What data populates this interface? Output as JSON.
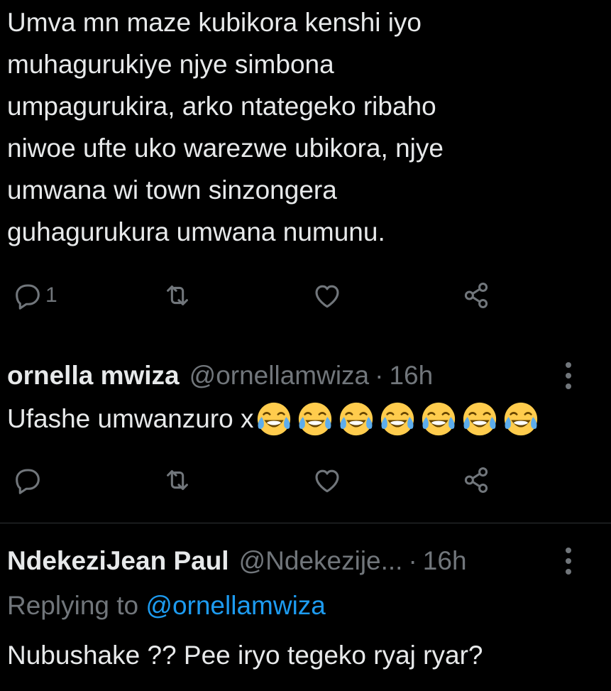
{
  "tweet1": {
    "text": "Umva mn maze kubikora kenshi iyo\nmuhagurukiye njye simbona\numpagurukira, arko ntategeko ribaho\nniwoe ufte uko warezwe ubikora, njye\numwana wi town sinzongera\nguhagurukura umwana numunu.",
    "reply_count": "1",
    "icons": [
      "reply-icon",
      "retweet-icon",
      "like-icon",
      "share-icon"
    ]
  },
  "tweet2": {
    "display_name": "ornella mwiza",
    "handle": "@ornellamwiza",
    "separator": "·",
    "time": "16h",
    "text": "Ufashe umwanzuro x",
    "emoji": "face-with-tears-of-joy",
    "emoji_count": 7,
    "icons": [
      "reply-icon",
      "retweet-icon",
      "like-icon",
      "share-icon"
    ]
  },
  "tweet3": {
    "display_name": "NdekeziJean Paul",
    "handle": "@Ndekezije...",
    "separator": "·",
    "time": "16h",
    "replying_prefix": "Replying to",
    "replying_to": "@ornellamwiza",
    "text": "Nubushake ?? Pee iryo tegeko ryaj ryar?"
  },
  "colors": {
    "background": "#000000",
    "text": "#e7e9ea",
    "muted": "#71767b",
    "link": "#1d9bf0",
    "divider": "#2f3336"
  }
}
